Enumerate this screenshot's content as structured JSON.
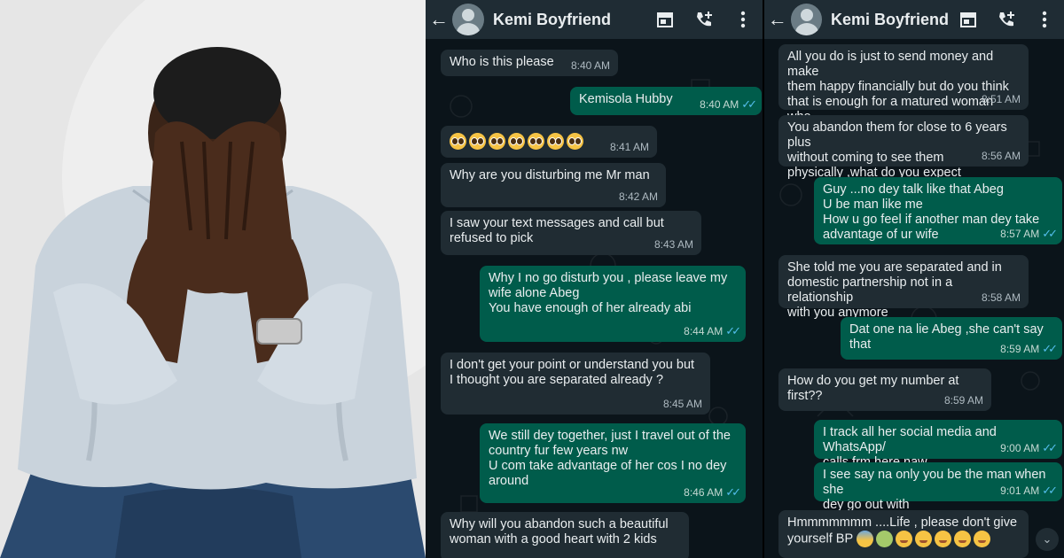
{
  "photo": {
    "description_icon": "man-covering-face-photo"
  },
  "chat_left": {
    "contact_name": "Kemi Boyfriend",
    "messages": [
      {
        "dir": "in",
        "text": "Who is this please",
        "time": "8:40 AM"
      },
      {
        "dir": "out",
        "text": "Kemisola Hubby",
        "time": "8:40 AM"
      },
      {
        "dir": "in",
        "text": "",
        "time": "8:41 AM"
      },
      {
        "dir": "in",
        "text": "Why are you disturbing me Mr man",
        "time": "8:42 AM"
      },
      {
        "dir": "in",
        "text": "I saw your text messages and call but\nrefused to pick",
        "time": "8:43 AM"
      },
      {
        "dir": "out",
        "text": "Why I no go disturb you , please leave my\nwife alone Abeg\nYou have enough of her already abi",
        "time": "8:44 AM"
      },
      {
        "dir": "in",
        "text": "I don't get your point or understand you but\nI thought you are separated already ?",
        "time": "8:45 AM"
      },
      {
        "dir": "out",
        "text": "We still dey together, just I travel out of the\ncountry fur few years nw\nU com take advantage of her cos I no dey\naround",
        "time": "8:46 AM"
      },
      {
        "dir": "in",
        "text": "Why will you abandon such a beautiful\nwoman with a good heart with 2 kids",
        "time": ""
      }
    ]
  },
  "chat_right": {
    "contact_name": "Kemi Boyfriend",
    "messages": [
      {
        "dir": "in",
        "text": "All you do is just to send money and make\nthem happy financially but do you think\nthat is enough for a matured woman who\nneed her man beside her",
        "time": "8:51 AM"
      },
      {
        "dir": "in",
        "text": "You abandon them for close to 6 years plus\nwithout coming to see them\nphysically ,what do you expect",
        "time": "8:56 AM"
      },
      {
        "dir": "out",
        "text": "Guy ...no dey talk like that Abeg\nU be man like me\nHow u go feel if another man dey take\nadvantage of ur wife",
        "time": "8:57 AM"
      },
      {
        "dir": "in",
        "text": "She told me you are separated and in\ndomestic partnership not in a relationship\nwith you anymore",
        "time": "8:58 AM"
      },
      {
        "dir": "out",
        "text": "Dat one na lie Abeg ,she can't say that",
        "time": "8:59 AM"
      },
      {
        "dir": "in",
        "text": "How do you get my number at first??",
        "time": "8:59 AM"
      },
      {
        "dir": "out",
        "text": "I track all her social media and WhatsApp/\ncalls frm here naw",
        "time": "9:00 AM"
      },
      {
        "dir": "out",
        "text": "I see say na only you be the man when she\ndey go out with",
        "time": "9:01 AM"
      },
      {
        "dir": "in",
        "text": "Hmmmmmmm ....Life , please don't give\nyourself BP",
        "time": ""
      }
    ]
  },
  "icons": {
    "back": "arrow-left-icon",
    "shop": "storefront-icon",
    "call": "add-call-icon",
    "menu": "more-vertical-icon",
    "scroll": "chevron-double-down-icon"
  },
  "colors": {
    "incoming": "#202c33",
    "outgoing": "#005c4b",
    "header": "#1f2c34",
    "read_tick": "#53bdeb",
    "background": "#0b141a"
  }
}
